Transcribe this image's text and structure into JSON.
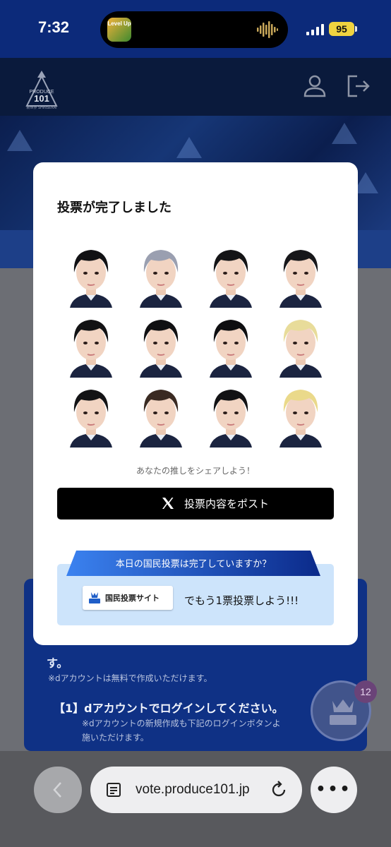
{
  "status_bar": {
    "time": "7:32",
    "battery": "95",
    "island_app_label": "Level Up"
  },
  "header": {
    "logo_text": "PRODUCE 101 JAPAN SHINSEKAI",
    "logo_top": "PRODUCE",
    "logo_num": "101",
    "logo_bottom": "新世界 SHINSEKAI"
  },
  "background": {
    "line1": "す。",
    "note1": "※dアカウントは無料で作成いただけます。",
    "step1": "【1】dアカウントでログインしてください。",
    "note2": "※dアカウントの新規作成も下記のログインボタンよ",
    "note3": "施いただけます。",
    "fab_badge": "12"
  },
  "modal": {
    "title": "投票が完了しました",
    "share_caption": "あなたの推しをシェアしよう！",
    "post_label": "投票内容をポスト",
    "ribbon_text": "本日の国民投票は完了していますか？",
    "site_button": "国民投票サイト",
    "vote_line": "でもう1票投票しよう!!!",
    "trainees": [
      {
        "hair": "#111114"
      },
      {
        "hair": "#9a9fb0"
      },
      {
        "hair": "#141416"
      },
      {
        "hair": "#17171a"
      },
      {
        "hair": "#121214"
      },
      {
        "hair": "#101012"
      },
      {
        "hair": "#0e0e10"
      },
      {
        "hair": "#e8dc9a"
      },
      {
        "hair": "#131315"
      },
      {
        "hair": "#3a2a22"
      },
      {
        "hair": "#121214"
      },
      {
        "hair": "#ead98a"
      }
    ]
  },
  "browser": {
    "url": "vote.produce101.jp"
  },
  "colors": {
    "brand_blue": "#0c2a7a",
    "ribbon_blue": "#1552c8",
    "vote_box": "#cde4fb"
  }
}
